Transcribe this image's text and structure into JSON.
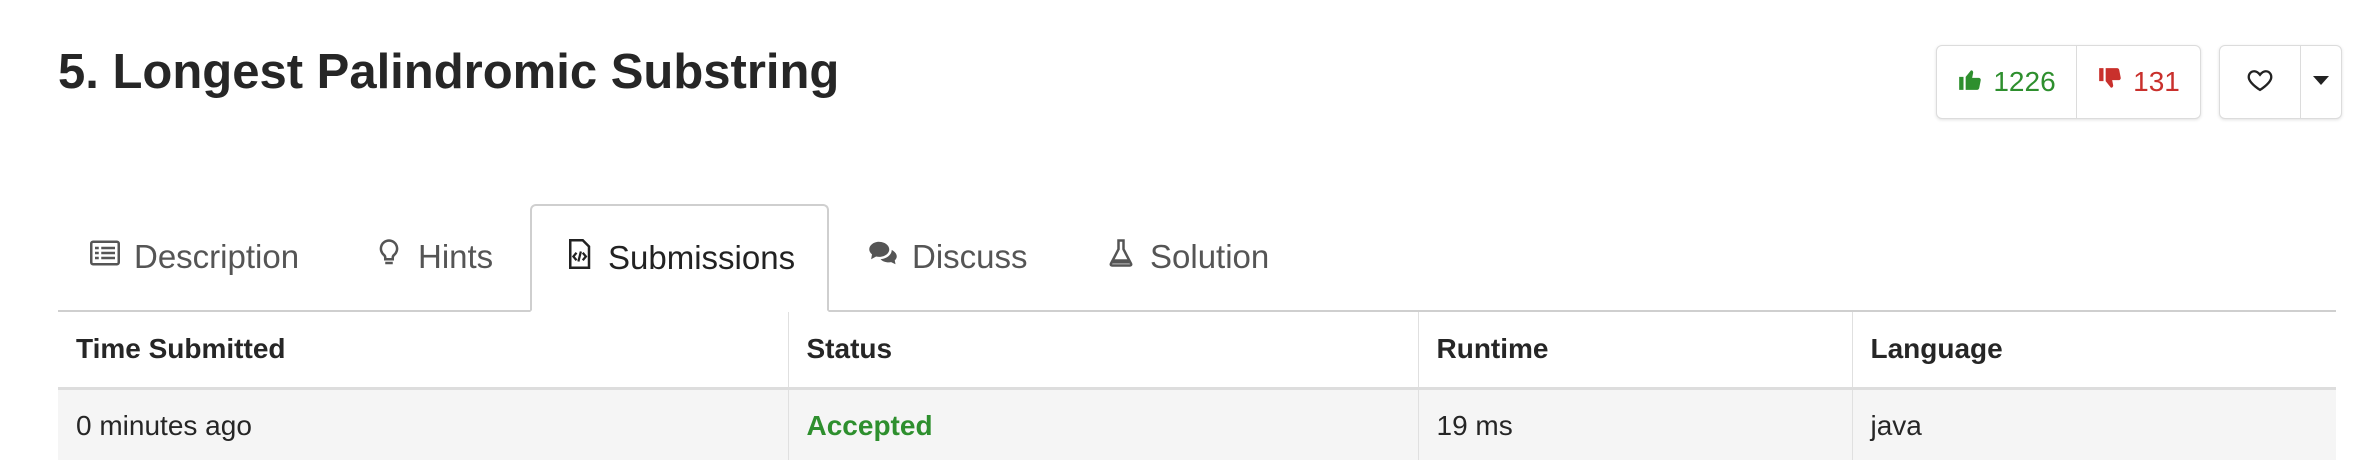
{
  "problem": {
    "title": "5. Longest Palindromic Substring"
  },
  "votes": {
    "likes": "1226",
    "dislikes": "131"
  },
  "tabs": [
    {
      "label": "Description",
      "icon": "list-icon"
    },
    {
      "label": "Hints",
      "icon": "lightbulb-icon"
    },
    {
      "label": "Submissions",
      "icon": "code-file-icon",
      "active": true
    },
    {
      "label": "Discuss",
      "icon": "comments-icon"
    },
    {
      "label": "Solution",
      "icon": "flask-icon"
    }
  ],
  "submissions": {
    "headers": [
      "Time Submitted",
      "Status",
      "Runtime",
      "Language"
    ],
    "rows": [
      {
        "time": "0 minutes ago",
        "status": "Accepted",
        "runtime": "19 ms",
        "language": "java"
      }
    ]
  },
  "colors": {
    "accent_green": "#2e8f2e",
    "accent_red": "#c9302c"
  }
}
